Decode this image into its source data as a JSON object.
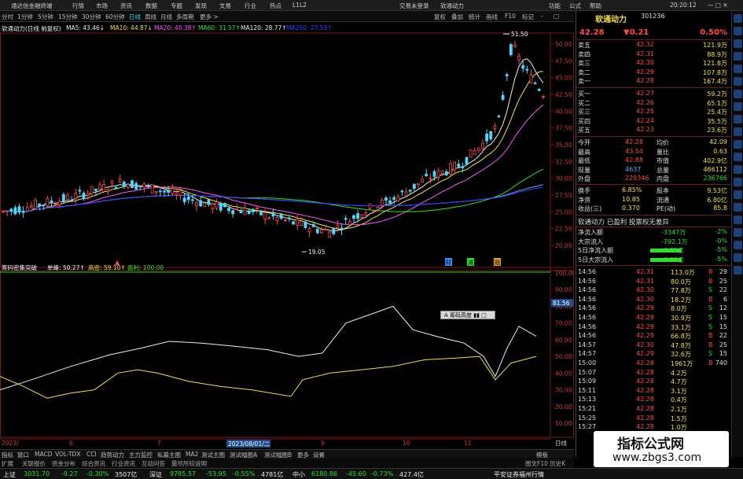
{
  "titlebar": {
    "app_title": "通达信金融终端",
    "menus": [
      "行情",
      "市场",
      "资讯",
      "数据",
      "专题",
      "发现",
      "文易",
      "行业",
      "热点",
      "L1L2"
    ],
    "center_links": [
      "交易未登录",
      "软通动力"
    ],
    "right_menus": [
      "功能",
      "公式",
      "帮助"
    ],
    "time": "20:20:12"
  },
  "periods": [
    "分时",
    "1分钟",
    "5分钟",
    "15分钟",
    "30分钟",
    "60分钟",
    "日线",
    "周线",
    "月线",
    "多周期",
    "更多 >"
  ],
  "selected_period": "日线",
  "toolbar_right": [
    "复权",
    "叠加",
    "统计",
    "画线",
    "F10",
    "标记",
    "-",
    "□"
  ],
  "ma_legend": {
    "title": "软通动力(日线 前复权)",
    "ma5": "MA5: 43.46↓",
    "ma10": "MA10: 44.87↓",
    "ma20": "MA20: 40.38↑",
    "ma60": "MA60: 31.57↑",
    "ma120": "MA120: 28.77↑",
    "ma250": "MA250: 27.53↑"
  },
  "price_axis": [
    "50.00",
    "47.50",
    "45.00",
    "42.50",
    "40.00",
    "37.50",
    "35.00",
    "32.50",
    "30.00",
    "27.50",
    "25.00",
    "22.50",
    "20.00"
  ],
  "price_annotations": {
    "high": "51.50",
    "low": "19.05"
  },
  "event_labels": [
    "财",
    "减",
    "融"
  ],
  "sub_legend": {
    "name": "筹码密集突破",
    "a_label": "单峰: 50.27↑",
    "b_label": "高密: 59.10↑",
    "c_label": "盈利: 100.00"
  },
  "sub_axis": [
    "100.00",
    "90.00",
    "80.00",
    "70.00",
    "60.00",
    "50.00",
    "40.00",
    "30.00",
    "20.00",
    "10.00"
  ],
  "sub_marker": "81.56",
  "popup_text": "A 筹码高度 ▮▮ □",
  "date_axis": {
    "start": "2023/",
    "labels": [
      "6",
      "7",
      "9",
      "10",
      "11"
    ],
    "cursor_date": "2023/08/01/二",
    "end": "日线"
  },
  "indicator_tabs": [
    "指标",
    "窗口",
    "MACD",
    "VOL-TDX",
    "CCI",
    "趋势动力",
    "主力监控",
    "私募主图",
    "MA2",
    "测试主图",
    "测试幅图A",
    "测试幅图B",
    "更多",
    "设置"
  ],
  "indicator_tabs_right": "模板",
  "ext_tabs": [
    "扩展",
    "关联报价",
    "资金分布",
    "综合资讯",
    "行业资讯",
    "互动问答",
    "最尽所较说明"
  ],
  "ext_right": "图文F10 历史K",
  "quote": {
    "name": "软通动力",
    "code": "301236",
    "price": "42.28",
    "change": "▼0.21",
    "pct": "0.50%",
    "asks": [
      {
        "label": "卖五",
        "price": "42.32",
        "vol": "121.9万"
      },
      {
        "label": "卖四",
        "price": "42.31",
        "vol": "88.9万"
      },
      {
        "label": "卖三",
        "price": "42.30",
        "vol": "121.8万"
      },
      {
        "label": "卖二",
        "price": "42.29",
        "vol": "107.8万"
      },
      {
        "label": "卖一",
        "price": "42.28",
        "vol": "167.4万"
      }
    ],
    "bids": [
      {
        "label": "买一",
        "price": "42.27",
        "vol": "59.2万"
      },
      {
        "label": "买二",
        "price": "42.26",
        "vol": "65.1万"
      },
      {
        "label": "买三",
        "price": "42.25",
        "vol": "25.4万"
      },
      {
        "label": "买四",
        "price": "42.24",
        "vol": "35.5万"
      },
      {
        "label": "买五",
        "price": "42.23",
        "vol": "23.6万"
      }
    ],
    "stats": [
      {
        "l1": "今开",
        "v1": "42.28",
        "l2": "均价",
        "v2": "42.09"
      },
      {
        "l1": "最高",
        "v1": "43.54",
        "l2": "量比",
        "v2": "0.63"
      },
      {
        "l1": "最低",
        "v1": "42.88",
        "l2": "市值",
        "v2": "402.9亿"
      },
      {
        "l1": "现量",
        "v1": "4637",
        "l2": "总量",
        "v2": "466112"
      },
      {
        "l1": "外盘",
        "v1": "229346",
        "l2": "内盘",
        "v2": "236766"
      }
    ],
    "stats2": [
      {
        "l1": "换手",
        "v1": "6.85%",
        "l2": "股本",
        "v2": "9.53亿"
      },
      {
        "l1": "净资",
        "v1": "10.85",
        "l2": "流通",
        "v2": "6.80亿"
      },
      {
        "l1": "收益(三)",
        "v1": "0.370",
        "l2": "PE(动)",
        "v2": "85.8"
      }
    ],
    "profit_line": "软通动力 已盈利 投票权无差异",
    "flows": [
      {
        "label": "净流入额",
        "value": "-3347万",
        "pct": "-2%"
      },
      {
        "label": "大宗流入",
        "value": "-792.1万",
        "pct": "-0%"
      },
      {
        "label": "5日净流入额",
        "value": "-6.85亿",
        "pct": "-5%"
      },
      {
        "label": "5日大宗流入",
        "value": "-6.88亿",
        "pct": "-5%"
      }
    ],
    "ticks": [
      {
        "t": "14:56",
        "p": "42.31",
        "v": "113.0万",
        "s": "B",
        "n": "29"
      },
      {
        "t": "14:56",
        "p": "42.31",
        "v": "80.0万",
        "s": "B",
        "n": "25"
      },
      {
        "t": "14:56",
        "p": "42.30",
        "v": "77.8万",
        "s": "S",
        "n": "22"
      },
      {
        "t": "14:56",
        "p": "42.30",
        "v": "18.2万",
        "s": "B",
        "n": "6"
      },
      {
        "t": "14:56",
        "p": "42.29",
        "v": "8.0万",
        "s": "S",
        "n": "12"
      },
      {
        "t": "14:56",
        "p": "42.29",
        "v": "30.9万",
        "s": "S",
        "n": "15"
      },
      {
        "t": "14:56",
        "p": "42.29",
        "v": "33.1万",
        "s": "S",
        "n": "15"
      },
      {
        "t": "14:56",
        "p": "42.29",
        "v": "66.8万",
        "s": "B",
        "n": "22"
      },
      {
        "t": "14:57",
        "p": "42.30",
        "v": "47.8万",
        "s": "B",
        "n": "25"
      },
      {
        "t": "14:57",
        "p": "42.29",
        "v": "32.6万",
        "s": "S",
        "n": "15"
      },
      {
        "t": "15:00",
        "p": "42.28",
        "v": "1961万",
        "s": "B",
        "n": "740"
      },
      {
        "t": "15:07",
        "p": "42.28",
        "v": "4.2万",
        "s": "",
        "n": ""
      },
      {
        "t": "15:09",
        "p": "42.28",
        "v": "4.7万",
        "s": "",
        "n": ""
      },
      {
        "t": "15:11",
        "p": "42.28",
        "v": "3.1万",
        "s": "",
        "n": ""
      },
      {
        "t": "15:13",
        "p": "42.28",
        "v": "0.4万",
        "s": "",
        "n": ""
      },
      {
        "t": "15:21",
        "p": "42.28",
        "v": "2.1万",
        "s": "",
        "n": ""
      },
      {
        "t": "15:25",
        "p": "42.28",
        "v": "1.5万",
        "s": "",
        "n": ""
      },
      {
        "t": "15:27",
        "p": "42.28",
        "v": "1.0万",
        "s": "",
        "n": ""
      }
    ]
  },
  "statusbar": {
    "sh": {
      "name": "上证",
      "price": "3031.70",
      "chg": "-9.27",
      "pct": "-0.30%",
      "amt": "3507亿"
    },
    "sz": {
      "name": "深证",
      "price": "9785.57",
      "chg": "-53.95",
      "pct": "-0.55%",
      "amt": "4781亿"
    },
    "zx": {
      "name": "中小",
      "price": "6180.86",
      "chg": "-45.60",
      "pct": "-0.73%",
      "amt": "427.4亿"
    },
    "right": "平安证券福州行情"
  },
  "watermark": {
    "title": "指标公式网",
    "url": "www.zbgs3.com"
  },
  "colors": {
    "up": "#ff4b4b",
    "down": "#4fd8ff",
    "ma5": "#eeeeee",
    "ma10": "#f4e04a",
    "ma20": "#ff55ff",
    "ma60": "#2ee02e",
    "ma120": "#6aa4ff",
    "ma250": "#3d3dff"
  }
}
